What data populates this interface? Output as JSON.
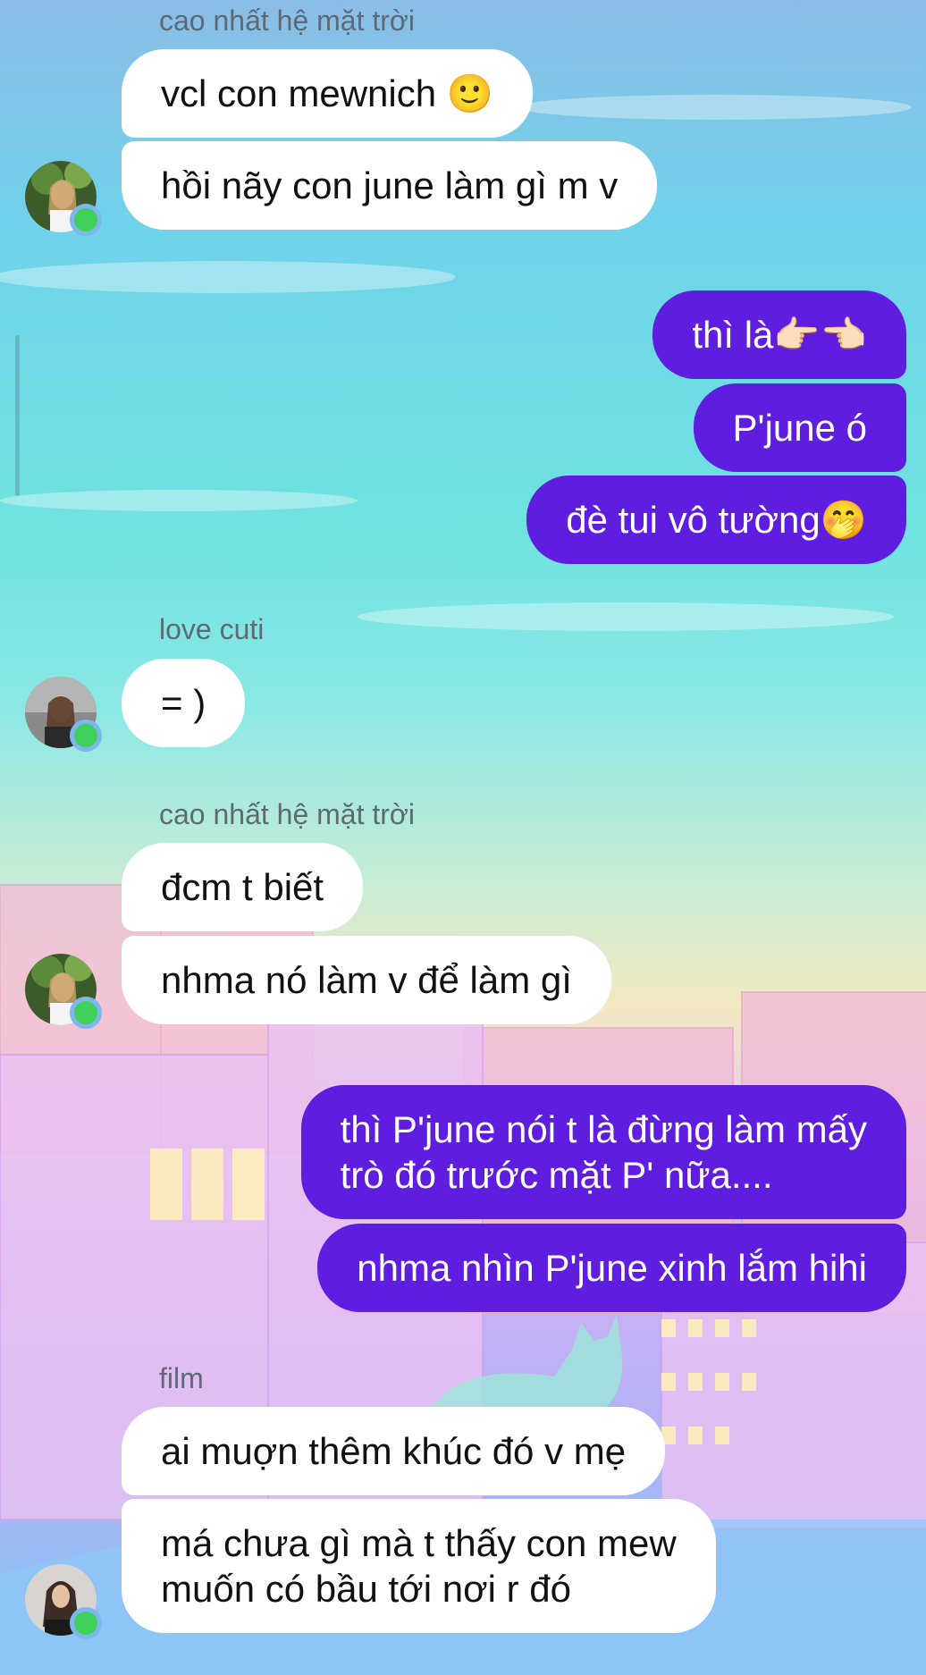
{
  "conversation": {
    "groups": [
      {
        "sender": "cao nhất hệ mặt trời",
        "messages": [
          "vcl con mewnich 🙂",
          "hồi nãy con june làm gì m v"
        ]
      },
      {
        "outgoing": [
          "thì là👉🏻👈🏻",
          "P'june ó",
          "đè tui vô tường🤭"
        ]
      },
      {
        "sender": "love cuti",
        "messages": [
          "= )"
        ]
      },
      {
        "sender": "cao nhất hệ mặt trời",
        "messages": [
          "đcm t biết",
          "nhma nó làm v để làm gì"
        ]
      },
      {
        "outgoing": [
          "thì P'june nói t là đừng làm mấy",
          "trò đó trước mặt P' nữa....",
          "nhma nhìn P'june xinh lắm hihi"
        ]
      },
      {
        "sender": "film",
        "messages": [
          "ai muợn thêm khúc đó v mẹ",
          "má chưa gì mà t thấy con mew",
          "muốn có bầu tới nơi r đó"
        ]
      }
    ]
  },
  "colors": {
    "outgoing_bubble": "#5f1de0",
    "incoming_bubble": "#ffffff",
    "presence_dot": "#3fd05a"
  }
}
